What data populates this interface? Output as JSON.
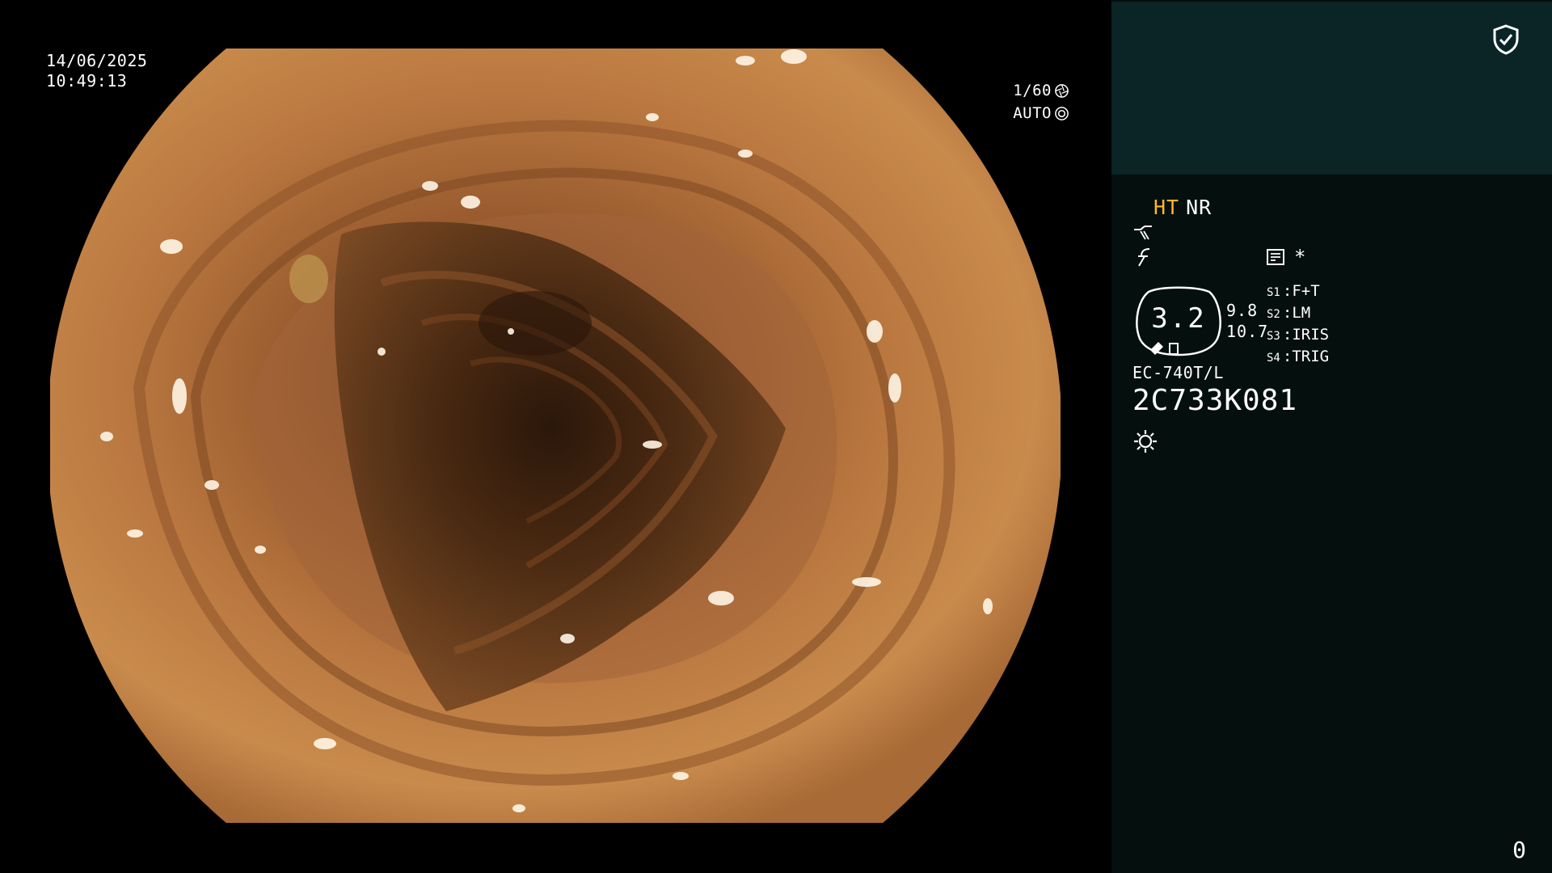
{
  "datetime": {
    "date": "14/06/2025",
    "time": "10:49:13"
  },
  "capture": {
    "shutter": "1/60",
    "iris_mode": "AUTO",
    "shutter_icon": "aperture-icon",
    "iris_icon": "iris-icon"
  },
  "status": {
    "shield_icon": "shield-check-icon",
    "mode_ht": "HT",
    "mode_nr": "NR",
    "enhancement_icon": "enhancement-curve-icon",
    "color_icon": "color-tone-icon",
    "menu_icon": "menu-list-icon",
    "asterisk": "*",
    "scale_value": "3.2",
    "range_top": "9.8",
    "range_bottom": "10.7",
    "switches": [
      {
        "key": "S1",
        "sep": ":",
        "value": "F+T"
      },
      {
        "key": "S2",
        "sep": ":",
        "value": "LM"
      },
      {
        "key": "S3",
        "sep": ":",
        "value": "IRIS"
      },
      {
        "key": "S4",
        "sep": ":",
        "value": "TRIG"
      }
    ],
    "scope_model": "EC-740T/L",
    "scope_serial": "2C733K081",
    "light_icon": "light-sun-icon",
    "counter": "0"
  },
  "colors": {
    "accent_ht": "#ffb630",
    "panel_top": "#0b2425",
    "panel_bottom": "#040f0e",
    "mucosa": "#b5733c",
    "lumen": "#3d2410"
  }
}
